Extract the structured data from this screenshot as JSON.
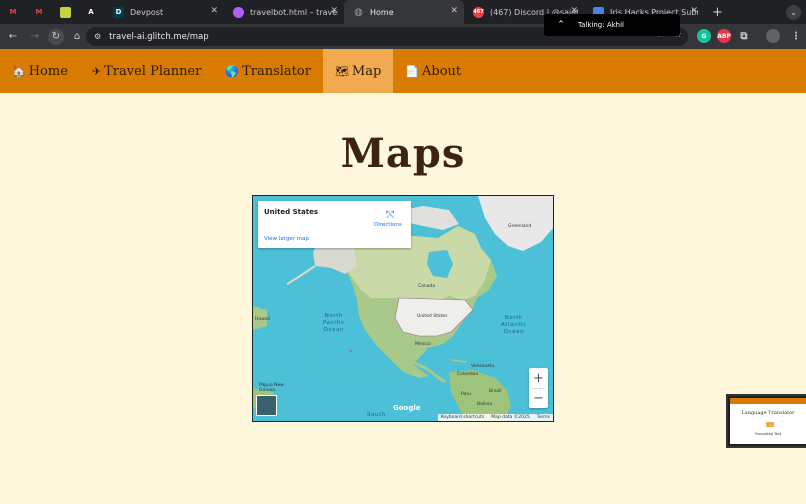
{
  "browser": {
    "tabs": [
      {
        "kind": "pinned",
        "icon": "gmail-icon",
        "label": "M",
        "color": "#ea4335"
      },
      {
        "kind": "pinned",
        "icon": "gmail-icon",
        "label": "M",
        "color": "#ea4335"
      },
      {
        "kind": "pinned",
        "icon": "app-icon",
        "label": "",
        "color": "#c7d33a"
      },
      {
        "kind": "pinned",
        "icon": "a-icon",
        "label": "A",
        "color": "#ffffff"
      },
      {
        "kind": "normal",
        "icon": "devpost-icon",
        "label": "D",
        "title": "Devpost",
        "color": "#003e54"
      },
      {
        "kind": "normal",
        "icon": "glitch-icon",
        "label": "",
        "title": "travelbot.html – travel-ai",
        "color": "#b45cff"
      },
      {
        "kind": "active",
        "icon": "globe-icon",
        "label": "",
        "title": "Home",
        "color": "#9aa0a6"
      },
      {
        "kind": "normal",
        "icon": "discord-icon",
        "label": "467",
        "title": "(467) Discord | @sajathb",
        "color": "#ed4245"
      },
      {
        "kind": "normal",
        "icon": "forms-icon",
        "label": "",
        "title": "Iris Hacks Project Submi",
        "color": "#4285f4"
      }
    ],
    "new_tab_label": "+",
    "tab_menu_label": "⌄",
    "url": "travel-ai.glitch.me/map",
    "talking_label": "Talking: Akhil",
    "extensions": [
      {
        "name": "grammarly-icon",
        "label": "G",
        "color": "#15c39a"
      },
      {
        "name": "adblock-icon",
        "label": "ABP",
        "color": "#e2364c"
      },
      {
        "name": "extensions-icon",
        "label": "⧉",
        "color": "#35363a"
      },
      {
        "name": "profile-avatar-icon",
        "label": "",
        "color": "#5f6368"
      },
      {
        "name": "menu-icon",
        "label": "⋮",
        "color": "#35363a"
      }
    ]
  },
  "nav": {
    "items": [
      {
        "id": "home",
        "icon": "🏠",
        "label": "Home",
        "active": false
      },
      {
        "id": "travel-planner",
        "icon": "✈",
        "label": "Travel Planner",
        "active": false
      },
      {
        "id": "translator",
        "icon": "🌎",
        "label": "Translator",
        "active": false
      },
      {
        "id": "map",
        "icon": "🗺",
        "label": "Map",
        "active": true
      },
      {
        "id": "about",
        "icon": "📄",
        "label": "About",
        "active": false
      }
    ]
  },
  "page": {
    "title": "Maps"
  },
  "map": {
    "place_name": "United States",
    "directions_label": "Directions",
    "view_larger_label": "View larger map",
    "ocean_labels": {
      "north_pacific": "North\nPacific\nOcean",
      "north_atlantic": "North\nAtlantic\nOcean",
      "south": "South"
    },
    "land_labels": {
      "greenland": "Greenland",
      "canada": "Canada",
      "united_states": "United States",
      "mexico": "Mexico",
      "venezuela": "Venezuela",
      "colombia": "Colombia",
      "peru": "Peru",
      "brazil": "Brazil",
      "bolivia": "Bolivia",
      "hawaii": "Hawaii",
      "papua": "Papua New\nGuinea"
    },
    "zoom_in_label": "+",
    "zoom_out_label": "−",
    "google_logo": "Google",
    "attribution": {
      "shortcuts": "Keyboard shortcuts",
      "map_data": "Map data ©2025",
      "terms": "Terms"
    }
  },
  "pip": {
    "title": "Language Translator",
    "subtitle": "Translated Text"
  }
}
